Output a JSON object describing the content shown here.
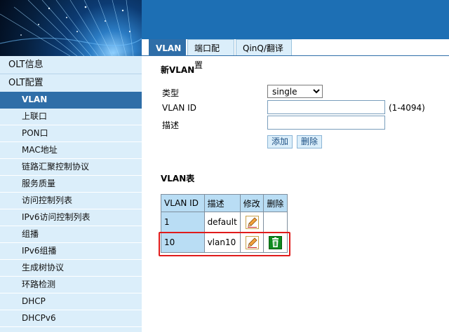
{
  "tabs": [
    {
      "label": "VLAN",
      "active": true
    },
    {
      "label": "端口配置",
      "active": false
    },
    {
      "label": "QinQ/翻译",
      "active": false
    }
  ],
  "sidebar": {
    "groups": [
      "OLT信息",
      "OLT配置"
    ],
    "items": [
      {
        "label": "VLAN",
        "active": true
      },
      {
        "label": "上联口"
      },
      {
        "label": "PON口"
      },
      {
        "label": "MAC地址"
      },
      {
        "label": "链路汇聚控制协议"
      },
      {
        "label": "服务质量"
      },
      {
        "label": "访问控制列表"
      },
      {
        "label": "IPv6访问控制列表"
      },
      {
        "label": "组播"
      },
      {
        "label": "IPv6组播"
      },
      {
        "label": "生成树协议"
      },
      {
        "label": "环路检测"
      },
      {
        "label": "DHCP"
      },
      {
        "label": "DHCPv6"
      }
    ]
  },
  "form": {
    "title": "新VLAN",
    "type_label": "类型",
    "type_value": "single",
    "type_options": [
      "single"
    ],
    "vlan_id_label": "VLAN ID",
    "vlan_id_value": "",
    "vlan_id_range": "(1-4094)",
    "desc_label": "描述",
    "desc_value": "",
    "add_label": "添加",
    "delete_label": "删除"
  },
  "table": {
    "title": "VLAN表",
    "headers": [
      "VLAN ID",
      "描述",
      "修改",
      "删除"
    ],
    "rows": [
      {
        "id": "1",
        "desc": "default",
        "editable": true,
        "deletable": false
      },
      {
        "id": "10",
        "desc": "vlan10",
        "editable": true,
        "deletable": true
      }
    ]
  },
  "colors": {
    "accent": "#2f6ea8",
    "header_blue": "#1d6fb4",
    "sidebar_bg": "#dbeefa",
    "table_header": "#b9ddf4",
    "highlight": "#e01b1b"
  },
  "icons": {
    "edit": "pencil-edit-icon",
    "delete": "trash-can-icon"
  }
}
